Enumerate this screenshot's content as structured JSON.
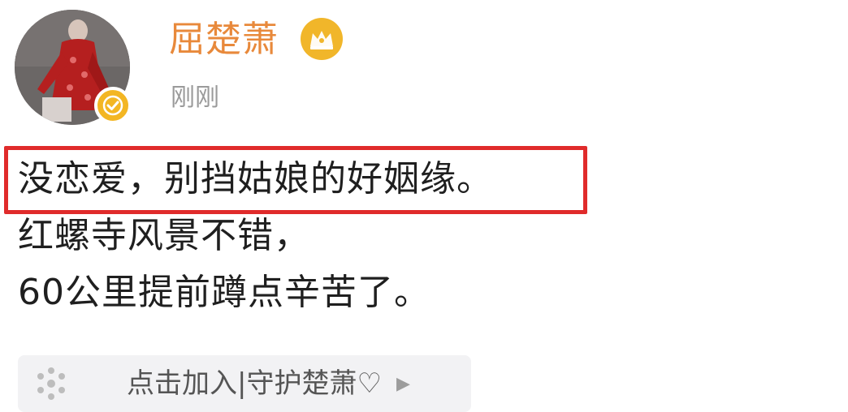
{
  "post": {
    "author": {
      "name": "屈楚萧",
      "verified_icon": "verified-check-icon",
      "member_icon": "crown-icon",
      "avatar_icon": "avatar-photo"
    },
    "timestamp": "刚刚",
    "lines": [
      "没恋爱，别挡姑娘的好姻缘。",
      "红螺寺风景不错，",
      "60公里提前蹲点辛苦了。"
    ],
    "highlighted_line_index": 0,
    "highlight_color": "#e02b2b"
  },
  "footer": {
    "join_label": "点击加入|守护楚萧♡",
    "join_icon": "sparkle-icon",
    "arrow_icon": "chevron-right-icon"
  },
  "colors": {
    "username": "#e8893b",
    "badge": "#f3b623",
    "timestamp": "#9a9a9a",
    "text": "#1f1f1f"
  }
}
